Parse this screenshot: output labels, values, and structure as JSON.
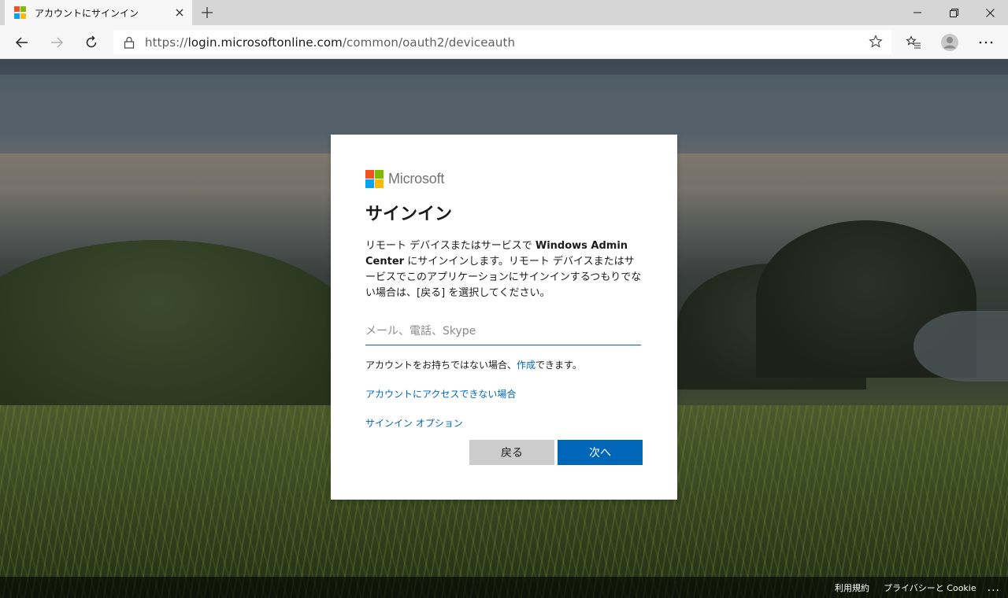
{
  "browser": {
    "tab_title": "アカウントにサインイン",
    "url_prefix": "https://",
    "url_host": "login.microsoftonline.com",
    "url_path": "/common/oauth2/deviceauth",
    "icons": [
      "back-icon",
      "forward-icon",
      "refresh-icon",
      "lock-icon",
      "favorite-star-icon",
      "favorites-icon",
      "profile-icon",
      "more-icon"
    ]
  },
  "card": {
    "brand": "Microsoft",
    "title": "サインイン",
    "desc_part1": "リモート デバイスまたはサービスで ",
    "desc_bold": "Windows Admin Center",
    "desc_part2": " にサインインします。リモート デバイスまたはサービスでこのアプリケーションにサインインするつもりでない場合は、[戻る] を選択してください。",
    "email_placeholder": "メール、電話、Skype",
    "email_value": "",
    "no_account_prefix": "アカウントをお持ちではない場合、",
    "no_account_link": "作成",
    "no_account_suffix": "できます。",
    "cant_access_link": "アカウントにアクセスできない場合",
    "signin_options_link": "サインイン オプション",
    "back_button": "戻る",
    "next_button": "次へ"
  },
  "footer": {
    "terms": "利用規約",
    "privacy": "プライバシーと Cookie",
    "more": "..."
  },
  "colors": {
    "accent": "#0067b8",
    "ms_red": "#f25022",
    "ms_green": "#7fba00",
    "ms_blue": "#00a4ef",
    "ms_yellow": "#ffb900"
  }
}
